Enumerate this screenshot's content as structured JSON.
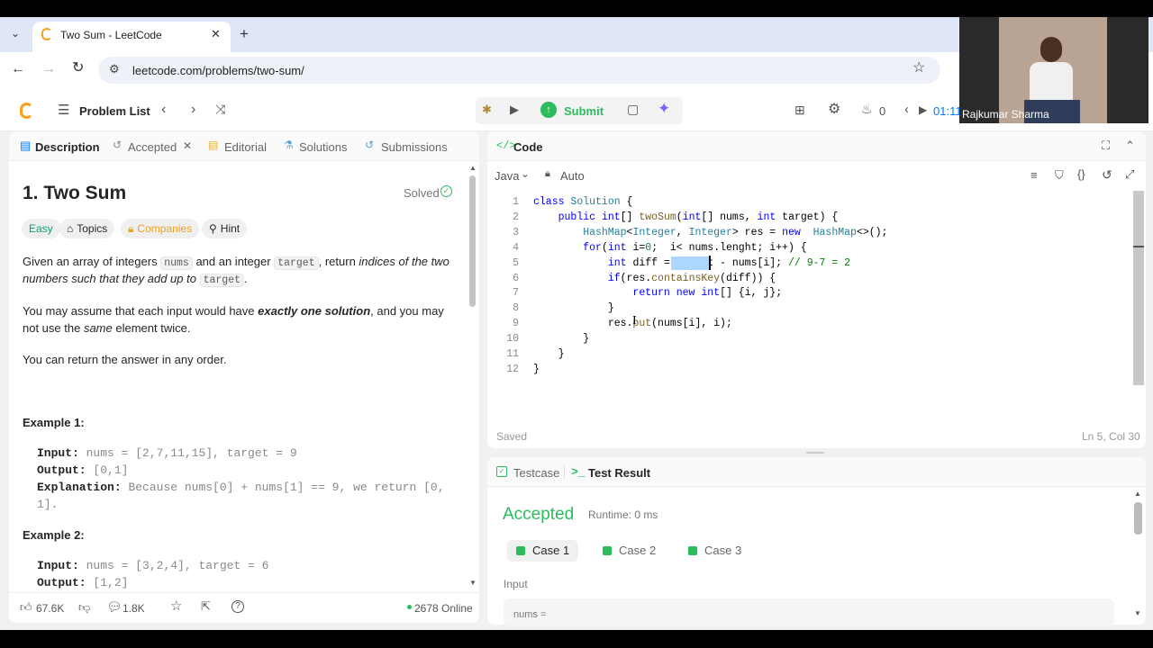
{
  "browser": {
    "tab_title": "Two Sum - LeetCode",
    "url": "leetcode.com/problems/two-sum/"
  },
  "webcam": {
    "name": "Rajkumar Sharma"
  },
  "nav": {
    "problem_list": "Problem List",
    "submit": "Submit",
    "streak_count": "0",
    "timer": "01:11"
  },
  "left_tabs": {
    "description": "Description",
    "accepted": "Accepted",
    "editorial": "Editorial",
    "solutions": "Solutions",
    "submissions": "Submissions"
  },
  "problem": {
    "title": "1. Two Sum",
    "status": "Solved",
    "difficulty": "Easy",
    "topics": "Topics",
    "companies": "Companies",
    "hint": "Hint",
    "desc_1a": "Given an array of integers",
    "desc_1b": "nums",
    "desc_1c": "and an integer",
    "desc_1d": "target",
    "desc_1e": ", return",
    "desc_1f": "indices of the two",
    "desc_2a": "numbers such that they add up to",
    "desc_2b": "target",
    "desc_2c": ".",
    "desc_3a": "You may assume that each input would have",
    "desc_3b": "exactly one solution",
    "desc_3c": ", and you may",
    "desc_4a": "not use the",
    "desc_4b": "same",
    "desc_4c": "element twice.",
    "desc_5": "You can return the answer in any order.",
    "example1_heading": "Example 1:",
    "ex1_input_label": "Input:",
    "ex1_input": "nums = [2,7,11,15], target = 9",
    "ex1_output_label": "Output:",
    "ex1_output": "[0,1]",
    "ex1_expl_label": "Explanation:",
    "ex1_expl_1": "Because nums[0] + nums[1] == 9, we return [0,",
    "ex1_expl_2": "1].",
    "example2_heading": "Example 2:",
    "ex2_input_label": "Input:",
    "ex2_input": "nums = [3,2,4], target = 6",
    "ex2_output_label": "Output:",
    "ex2_output": "[1,2]"
  },
  "footer": {
    "likes": "67.6K",
    "comments": "1.8K",
    "online": "2678 Online"
  },
  "code_panel": {
    "title": "Code",
    "language": "Java",
    "mode": "Auto",
    "saved": "Saved",
    "cursor": "Ln 5, Col 30",
    "lines": [
      "class Solution {",
      "    public int[] twoSum(int[] nums, int target) {",
      "        HashMap<Integer, Integer> res = new  HashMap<>();",
      "        for(int i=0;  i< nums.lenght; i++) {",
      "            int diff = target - nums[i]; // 9-7 = 2",
      "            if(res.containsKey(diff)) {",
      "                return new int[] {i, j};",
      "            }",
      "            res.put(nums[i], i);",
      "        }",
      "    }",
      "}"
    ]
  },
  "result_panel": {
    "testcase_tab": "Testcase",
    "result_tab": "Test Result",
    "verdict": "Accepted",
    "runtime": "Runtime: 0 ms",
    "cases": [
      "Case 1",
      "Case 2",
      "Case 3"
    ],
    "input_label": "Input",
    "input_value": "nums ="
  }
}
